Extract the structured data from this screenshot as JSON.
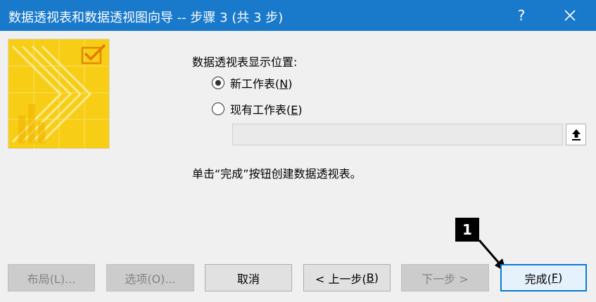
{
  "window": {
    "title": "数据透视表和数据透视图向导 -- 步骤 3 (共 3 步)",
    "help_label": "?",
    "close_icon": "close-icon"
  },
  "wizard_image": {
    "icon": "wizard-illustration",
    "accent": "#f6c700"
  },
  "placement": {
    "heading": "数据透视表显示位置:",
    "options": [
      {
        "label_before": "新工作表(",
        "mnemonic": "N",
        "label_after": ")",
        "selected": true
      },
      {
        "label_before": "现有工作表(",
        "mnemonic": "E",
        "label_after": ")",
        "selected": false
      }
    ],
    "location_value": "",
    "collapse_icon": "collapse-dialog-icon"
  },
  "hint": "单击“完成”按钮创建数据透视表。",
  "annotation": {
    "step_number": "1",
    "arrow_icon": "arrow-icon"
  },
  "buttons": {
    "layout": {
      "label": "布局(L)...",
      "enabled": false
    },
    "options": {
      "label": "选项(O)...",
      "enabled": false
    },
    "cancel": {
      "label": "取消",
      "enabled": true
    },
    "back": {
      "label_before": "< 上一步(",
      "mnemonic": "B",
      "label_after": ")",
      "enabled": true
    },
    "next": {
      "label": "下一步 >",
      "enabled": false
    },
    "finish": {
      "label_before": "完成(",
      "mnemonic": "F",
      "label_after": ")",
      "enabled": true,
      "default": true
    }
  },
  "colors": {
    "titlebar": "#1979ca",
    "accent": "#0078d7",
    "dialog_bg": "#f0f0f0",
    "image_yellow": "#f6c700"
  }
}
